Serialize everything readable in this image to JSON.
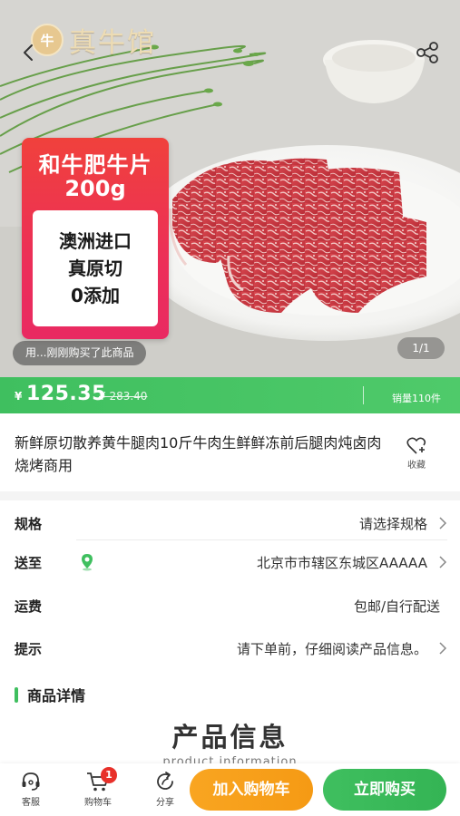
{
  "hero": {
    "brand": "真牛馆",
    "tag": {
      "title": "和牛肥牛片",
      "weight": "200g",
      "lines": [
        "澳洲进口",
        "真原切",
        "0添加"
      ]
    },
    "buyer_notice": "用...刚刚购买了此商品",
    "page_indicator": "1/1"
  },
  "price": {
    "currency": "¥",
    "current": "125.35",
    "original": "¥ 283.40",
    "sales": "销量110件"
  },
  "product": {
    "title": "新鲜原切散养黄牛腿肉10斤牛肉生鲜鲜冻前后腿肉炖卤肉烧烤商用",
    "favorite_label": "收藏"
  },
  "rows": {
    "spec": {
      "label": "规格",
      "value": "请选择规格"
    },
    "delivery": {
      "label": "送至",
      "value": "北京市市辖区东城区AAAAA"
    },
    "shipping": {
      "label": "运费",
      "value": "包邮/自行配送"
    },
    "tip": {
      "label": "提示",
      "value": "请下单前，仔细阅读产品信息。"
    }
  },
  "details": {
    "heading": "商品详情",
    "info_title": "产品信息",
    "info_subtitle": "product information"
  },
  "bottom_bar": {
    "service": "客服",
    "cart": "购物车",
    "cart_count": "1",
    "share": "分享",
    "add_to_cart": "加入购物车",
    "buy_now": "立即购买"
  },
  "colors": {
    "accent_green": "#3fbf5f",
    "cart_orange": "#f7a01a",
    "badge_red": "#e8302a",
    "tag_red": "#ec2f58"
  },
  "icons": [
    "back-icon",
    "share-icon",
    "favorite-heart-icon",
    "location-pin-icon",
    "chevron-right-icon",
    "customer-service-icon",
    "cart-icon",
    "share-refresh-icon"
  ]
}
